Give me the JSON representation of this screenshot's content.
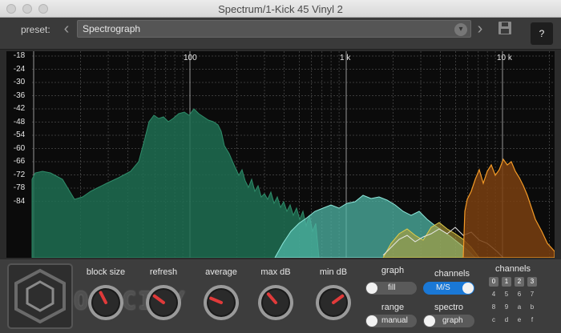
{
  "window": {
    "title": "Spectrum/1-Kick 45 Vinyl 2"
  },
  "preset": {
    "label": "preset:",
    "value": "Spectrograph",
    "prev_icon": "chevron-left-icon",
    "next_icon": "chevron-right-icon",
    "save_icon": "save-icon"
  },
  "help": {
    "label": "?"
  },
  "spectrum": {
    "y_labels": [
      "-18",
      "-24",
      "-30",
      "-36",
      "-42",
      "-48",
      "-54",
      "-60",
      "-66",
      "-72",
      "-78",
      "-84"
    ],
    "x_labels": [
      "100",
      "1 k",
      "10 k"
    ],
    "colors": {
      "green": "#1f6e52",
      "teal": "#5fc7b8",
      "white": "#e8e8e8",
      "yellow": "#c9b23a",
      "orange": "#e88a1c"
    }
  },
  "brand": {
    "name": "OC CITY"
  },
  "knobs": [
    {
      "label": "block size",
      "name": "block-size-knob",
      "level": 0.4
    },
    {
      "label": "refresh",
      "name": "refresh-knob",
      "level": 0.3
    },
    {
      "label": "average",
      "name": "average-knob",
      "level": 0.25
    },
    {
      "label": "max dB",
      "name": "max-db-knob",
      "level": 0.35
    },
    {
      "label": "min dB",
      "name": "min-db-knob",
      "level": 0.7
    }
  ],
  "graph": {
    "label": "graph",
    "value": "fill"
  },
  "channels_toggle": {
    "label": "channels",
    "value": "M/S"
  },
  "range": {
    "label": "range",
    "value": "manual"
  },
  "spectro": {
    "label": "spectro",
    "value": "graph"
  },
  "channels": {
    "label": "channels",
    "rows": [
      [
        "0",
        "1",
        "2",
        "3"
      ],
      [
        "4",
        "5",
        "6",
        "7"
      ],
      [
        "8",
        "9",
        "a",
        "b"
      ],
      [
        "c",
        "d",
        "e",
        "f"
      ]
    ],
    "selected": [
      "0",
      "1",
      "2",
      "3"
    ]
  }
}
